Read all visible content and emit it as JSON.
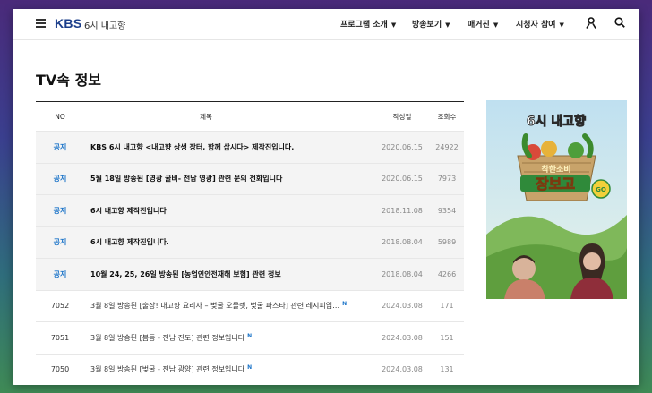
{
  "header": {
    "logo": "KBS",
    "program": "6시 내고향",
    "nav": [
      {
        "label": "프로그램 소개"
      },
      {
        "label": "방송보기"
      },
      {
        "label": "매거진"
      },
      {
        "label": "시청자 참여"
      }
    ],
    "icons": [
      "menu-icon",
      "user-icon",
      "search-icon"
    ]
  },
  "page": {
    "title": "TV속 정보"
  },
  "table": {
    "headers": {
      "no": "NO",
      "title": "제목",
      "date": "작성일",
      "views": "조회수"
    },
    "rows": [
      {
        "no": "공지",
        "title": "KBS 6시 내고향 <내고향 상생 장터, 함께 삽시다> 제작진입니다.",
        "date": "2020.06.15",
        "views": "24922",
        "notice": true,
        "new": false
      },
      {
        "no": "공지",
        "title": "5월 18일 방송된 [영광 굴비- 전남 영광] 관련 문의 전화입니다",
        "date": "2020.06.15",
        "views": "7973",
        "notice": true,
        "new": false
      },
      {
        "no": "공지",
        "title": "6시 내고향 제작진입니다",
        "date": "2018.11.08",
        "views": "9354",
        "notice": true,
        "new": false
      },
      {
        "no": "공지",
        "title": "6시 내고향 제작진입니다.",
        "date": "2018.08.04",
        "views": "5989",
        "notice": true,
        "new": false
      },
      {
        "no": "공지",
        "title": "10월 24, 25, 26일 방송된 [농업인안전재해 보험] 관련 정보",
        "date": "2018.08.04",
        "views": "4266",
        "notice": true,
        "new": false
      },
      {
        "no": "7052",
        "title": "3월 8일 방송된 [출장! 내고향 요리사 – 벚굴 오믈렛, 벚굴 파스타] 관련 레시피입…",
        "date": "2024.03.08",
        "views": "171",
        "notice": false,
        "new": true
      },
      {
        "no": "7051",
        "title": "3월 8일 방송된 [봄동 - 전남 진도] 관련 정보입니다",
        "date": "2024.03.08",
        "views": "151",
        "notice": false,
        "new": true
      },
      {
        "no": "7050",
        "title": "3월 8일 방송된 [벚굴 - 전남 광양] 관련 정보입니다",
        "date": "2024.03.08",
        "views": "131",
        "notice": false,
        "new": true
      }
    ],
    "new_badge": "N"
  },
  "banner": {
    "badge": "6시 내고향",
    "subtitle": "착한소비",
    "title": "장보고",
    "go": "GO"
  },
  "colors": {
    "accent": "#1a73c8",
    "brand": "#1a3d8a"
  }
}
